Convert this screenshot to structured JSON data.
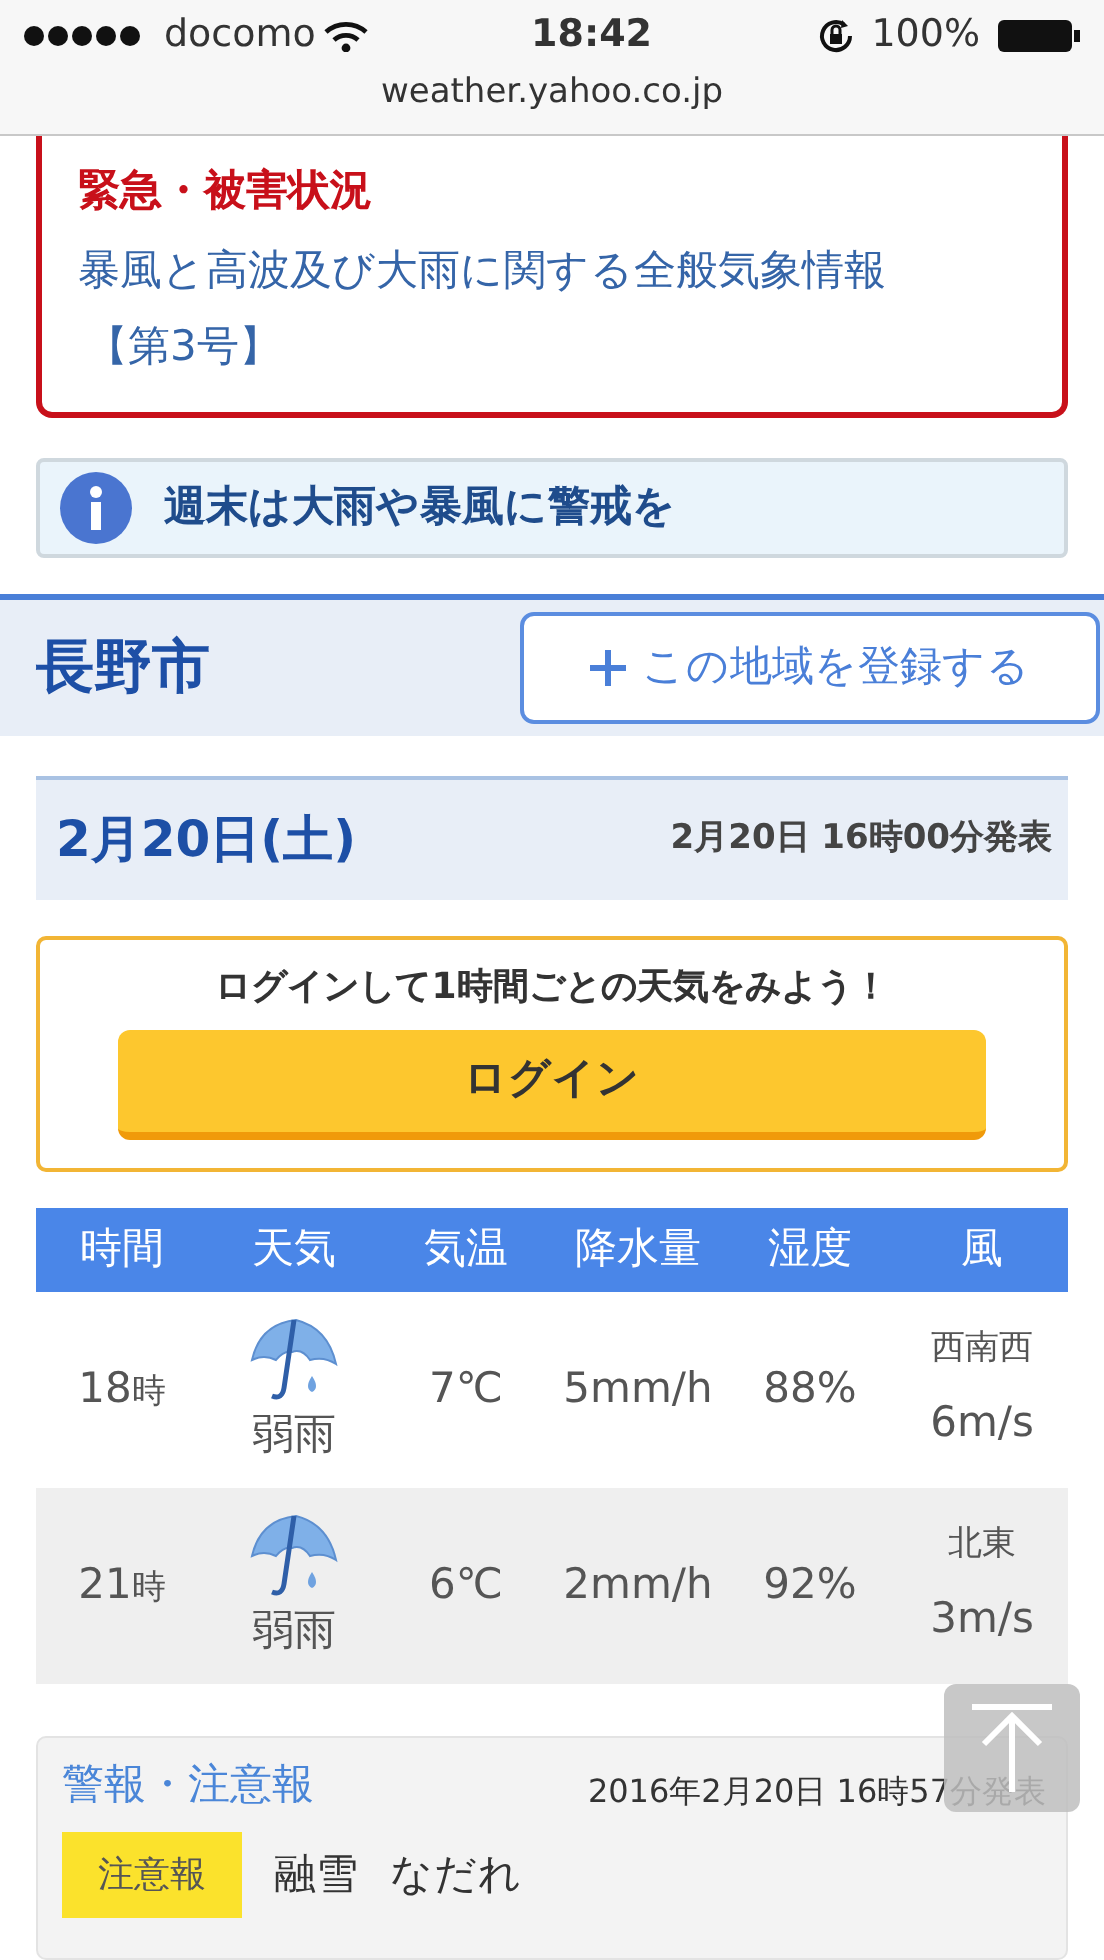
{
  "status_bar": {
    "carrier": "docomo",
    "time": "18:42",
    "battery": "100%",
    "url": "weather.yahoo.co.jp"
  },
  "emergency": {
    "heading": "緊急・被害状況",
    "link": "暴風と高波及び大雨に関する全般気象情報",
    "issue": "【第3号】"
  },
  "notice": {
    "text": "週末は大雨や暴風に警戒を"
  },
  "location": {
    "name": "長野市",
    "register_button": "この地域を登録する"
  },
  "date_bar": {
    "date": "2月20日(土)",
    "issued": "2月20日 16時00分発表"
  },
  "login_prompt": {
    "text": "ログインして1時間ごとの天気をみよう！",
    "button": "ログイン"
  },
  "forecast": {
    "columns": [
      "時間",
      "天気",
      "気温",
      "降水量",
      "湿度",
      "風"
    ],
    "rows": [
      {
        "hour": "18",
        "hour_unit": "時",
        "weather": "弱雨",
        "temperature": "7℃",
        "precipitation": "5mm/h",
        "humidity": "88%",
        "wind_direction": "西南西",
        "wind_speed": "6m/s"
      },
      {
        "hour": "21",
        "hour_unit": "時",
        "weather": "弱雨",
        "temperature": "6℃",
        "precipitation": "2mm/h",
        "humidity": "92%",
        "wind_direction": "北東",
        "wind_speed": "3m/s"
      }
    ]
  },
  "warnings": {
    "title": "警報・注意報",
    "issued": "2016年2月20日 16時57分発表",
    "items": [
      {
        "level": "注意報",
        "names": [
          "融雪",
          "なだれ"
        ]
      }
    ]
  }
}
